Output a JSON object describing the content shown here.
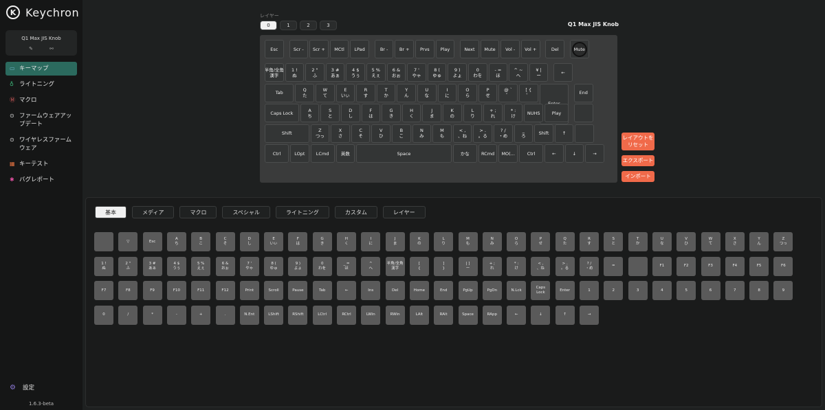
{
  "app": {
    "brand": "Keychron",
    "logo_glyph": "K",
    "device_name": "Q1 Max JIS Knob",
    "version": "1.6.3-beta"
  },
  "nav": [
    {
      "icon": "keyboard-icon",
      "glyph": "▭",
      "color": "#6fb0c8",
      "label": "キーマップ",
      "active": true
    },
    {
      "icon": "lightbulb-icon",
      "glyph": "♁",
      "color": "#3fc080",
      "label": "ライトニング"
    },
    {
      "icon": "macro-icon",
      "glyph": "Ⓜ",
      "color": "#e06060",
      "label": "マクロ"
    },
    {
      "icon": "firmware-update-icon",
      "glyph": "⊙",
      "color": "#dddddd",
      "label": "ファームウェアアップデート"
    },
    {
      "icon": "wireless-firmware-icon",
      "glyph": "⊙",
      "color": "#dddddd",
      "label": "ワイヤレスファームウェア"
    },
    {
      "icon": "key-test-icon",
      "glyph": "▦",
      "color": "#e07040",
      "label": "キーテスト"
    },
    {
      "icon": "bug-icon",
      "glyph": "✱",
      "color": "#e050a0",
      "label": "バグレポート"
    }
  ],
  "settings": {
    "icon": "gear-icon",
    "glyph": "⚙",
    "label": "設定"
  },
  "layers": {
    "label": "レイヤー",
    "tabs": [
      "0",
      "1",
      "2",
      "3"
    ],
    "active": 0
  },
  "keyboard_title": "Q1 Max JIS Knob",
  "side_buttons": [
    "レイアウトを\nリセット",
    "エクスポート",
    "インポート"
  ],
  "keyboard_keys": [
    [
      "Esc",
      "",
      "Scr -",
      "",
      "Scr +",
      "",
      "MCtl",
      "",
      "LPad",
      "",
      "Br -",
      "",
      "Br +",
      "",
      "Prvs",
      "",
      "Play",
      "",
      "Next",
      "",
      "Mute",
      "",
      "Vol -",
      "",
      "Vol +",
      "",
      "Del",
      "",
      "Mute",
      ""
    ],
    [
      "半角/全角",
      "漢字",
      "1 !",
      "ぬ",
      "2 \"",
      "ふ",
      "3 #",
      "あぁ",
      "4 $",
      "うぅ",
      "5 %",
      "えぇ",
      "6 &",
      "おぉ",
      "7 '",
      "やゃ",
      "8 (",
      "ゆゅ",
      "9 )",
      "よょ",
      "0",
      "わを",
      "- =",
      "ほ",
      "^ ~",
      "へ",
      "¥ |",
      "ー",
      "←",
      "",
      "Home",
      ""
    ],
    [
      "Tab",
      "",
      "Q",
      "た",
      "W",
      "て",
      "E",
      "いぃ",
      "R",
      "す",
      "T",
      "か",
      "Y",
      "ん",
      "U",
      "な",
      "I",
      "に",
      "O",
      "ら",
      "P",
      "せ",
      "@ `",
      "゛",
      "[ {",
      "゜",
      "Enter",
      "",
      "End",
      ""
    ],
    [
      "Caps Lock",
      "",
      "A",
      "ち",
      "S",
      "と",
      "D",
      "し",
      "F",
      "は",
      "G",
      "き",
      "H",
      "く",
      "J",
      "ま",
      "K",
      "の",
      "L",
      "り",
      "+ ;",
      "れ",
      "* :",
      "け",
      "NUHS",
      "",
      "Play",
      ""
    ],
    [
      "Shift",
      "",
      "Z",
      "つっ",
      "X",
      "さ",
      "C",
      "そ",
      "V",
      "ひ",
      "B",
      "こ",
      "N",
      "み",
      "M",
      "も",
      "< ,",
      "、ね",
      "> .",
      "。る",
      "? /",
      "・め",
      "_",
      "ろ",
      "Shift",
      "",
      "↑",
      ""
    ],
    [
      "Ctrl",
      "",
      "LOpt",
      "",
      "LCmd",
      "",
      "英数",
      "",
      "Space",
      "",
      "かな",
      "",
      "RCmd",
      "",
      "MO(...",
      "",
      "Ctrl",
      "",
      "←",
      "",
      "↓",
      "",
      "→",
      ""
    ]
  ],
  "categories": [
    "基本",
    "メディア",
    "マクロ",
    "スペシャル",
    "ライトニング",
    "カスタム",
    "レイヤー"
  ],
  "active_category": 0,
  "palette_keys": [
    [
      "",
      "",
      "▽",
      "",
      "Esc",
      "",
      "A",
      "ち",
      "B",
      "こ",
      "C",
      "そ",
      "D",
      "し",
      "E",
      "いぃ",
      "F",
      "は",
      "G",
      "き",
      "H",
      "く",
      "I",
      "に",
      "J",
      "ま",
      "K",
      "の",
      "L",
      "り",
      "M",
      "も",
      "N",
      "み",
      "O",
      "ら",
      "P",
      "せ",
      "Q",
      "た",
      "R",
      "す",
      "S",
      "と",
      "T",
      "か",
      "U",
      "な",
      "V",
      "ひ",
      "W",
      "て",
      "X",
      "さ",
      "Y",
      "ん",
      "Z",
      "つっ"
    ],
    [
      "1 !",
      "ぬ",
      "2 \"",
      "ふ",
      "3 #",
      "あぁ",
      "4 $",
      "うぅ",
      "5 %",
      "えぇ",
      "6 &",
      "おぉ",
      "7 '",
      "やゃ",
      "8 (",
      "ゆゅ",
      "9 )",
      "よょ",
      "0",
      "わを",
      "_ =",
      "ほ",
      "^",
      "へ",
      "半角/全角",
      "漢字",
      "[",
      "{",
      "]",
      "}",
      "| ]",
      "ー",
      "+ ;",
      "れ",
      "* :",
      "け",
      "< ,",
      "、ね",
      "> .",
      "。る",
      "? /",
      "・め",
      "=",
      "",
      "",
      "",
      "F1",
      "",
      "F2",
      "",
      "F3",
      "",
      "F4",
      "",
      "F5",
      "",
      "F6",
      ""
    ],
    [
      "F7",
      "",
      "F8",
      "",
      "F9",
      "",
      "F10",
      "",
      "F11",
      "",
      "F12",
      "",
      "Print",
      "",
      "Scroll",
      "",
      "Pause",
      "",
      "Tab",
      "",
      "←",
      "",
      "Ins",
      "",
      "Del",
      "",
      "Home",
      "",
      "End",
      "",
      "PgUp",
      "",
      "PgDn",
      "",
      "N.Lck",
      "",
      "Caps",
      "Lock",
      "Enter",
      "",
      "1",
      "",
      "2",
      "",
      "3",
      "",
      "4",
      "",
      "5",
      "",
      "6",
      "",
      "7",
      "",
      "8",
      "",
      "9",
      ""
    ],
    [
      "0",
      "",
      "/",
      "",
      "*",
      "",
      "-",
      "",
      "+",
      "",
      ".",
      "",
      "N.Ent",
      "",
      "LShift",
      "",
      "RShift",
      "",
      "LCtrl",
      "",
      "RCtrl",
      "",
      "LWin",
      "",
      "RWin",
      "",
      "LAlt",
      "",
      "RAlt",
      "",
      "Space",
      "",
      "RApp",
      "",
      "←",
      "",
      "↓",
      "",
      "↑",
      "",
      "→",
      ""
    ]
  ]
}
